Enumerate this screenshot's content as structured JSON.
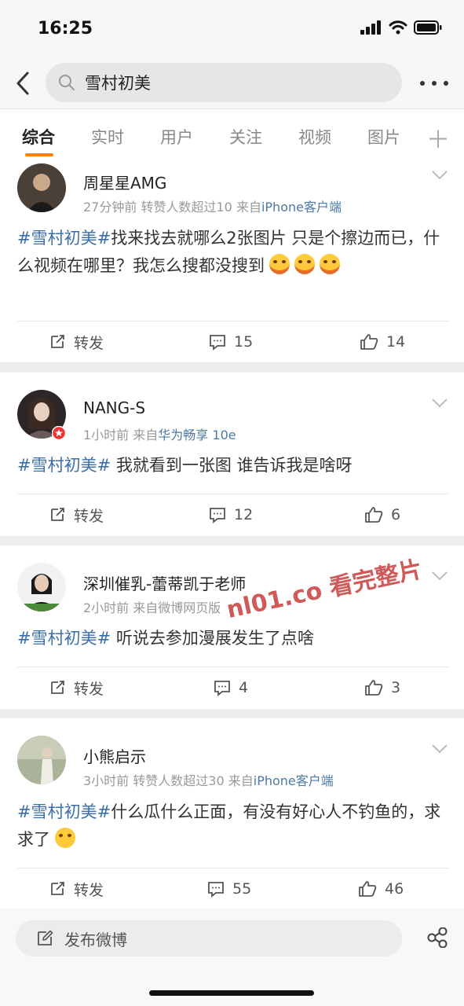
{
  "status_bar": {
    "time": "16:25"
  },
  "header": {
    "search_text": "雪村初美"
  },
  "tabs": [
    "综合",
    "实时",
    "用户",
    "关注",
    "视频",
    "图片"
  ],
  "posts": [
    {
      "author": "周星星AMG",
      "time": "27分钟前",
      "extra": "转赞人数超过10",
      "from": "来自",
      "source": "iPhone客户端",
      "hashtag": "#雪村初美#",
      "text": "找来找去就哪么2张图片 只是个擦边而已，什么视频在哪里？我怎么搜都没搜到",
      "repost_label": "转发",
      "comments": "15",
      "likes": "14"
    },
    {
      "author": "NANG-S",
      "time": "1小时前",
      "extra": "",
      "from": "来自",
      "source": "华为畅享 10e",
      "hashtag": "#雪村初美#",
      "text": " 我就看到一张图 谁告诉我是啥呀",
      "repost_label": "转发",
      "comments": "12",
      "likes": "6"
    },
    {
      "author": "深圳催乳-蕾蒂凯于老师",
      "time": "2小时前",
      "extra": "",
      "from": "来自微博网页版",
      "source": "",
      "hashtag": "#雪村初美#",
      "text": " 听说去参加漫展发生了点啥",
      "repost_label": "转发",
      "comments": "4",
      "likes": "3"
    },
    {
      "author": "小熊启示",
      "time": "3小时前",
      "extra": "转赞人数超过30",
      "from": "来自",
      "source": "iPhone客户端",
      "hashtag": "#雪村初美#",
      "text": "什么瓜什么正面，有没有好心人不钓鱼的，求求了",
      "repost_label": "转发",
      "comments": "55",
      "likes": "46"
    }
  ],
  "watermark": "nl01.co 看完整片",
  "bottom_bar": {
    "compose_label": "发布微博"
  },
  "colors": {
    "accent": "#ff8200",
    "hashtag": "#3b6ea8",
    "source_link": "#4b79a5"
  }
}
